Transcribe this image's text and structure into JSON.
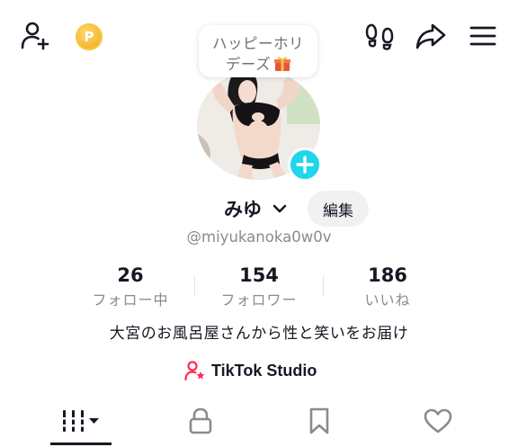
{
  "header": {
    "add_friend_icon": "person-plus-icon",
    "coin_icon": "coin-icon",
    "coin_glyph": "P",
    "footprints_icon": "footprints-icon",
    "share_icon": "share-arrow-icon",
    "menu_icon": "hamburger-menu-icon"
  },
  "holiday_bubble": {
    "line1": "ハッピーホリ",
    "line2": "デーズ",
    "icon": "gift-icon"
  },
  "profile": {
    "username": "みゆ",
    "edit_label": "編集",
    "handle": "@miyukanoka0w0v",
    "bio": "大宮のお風呂屋さんから性と笑いをお届け"
  },
  "stats": {
    "following": {
      "value": "26",
      "label": "フォロー中"
    },
    "followers": {
      "value": "154",
      "label": "フォロワー"
    },
    "likes": {
      "value": "186",
      "label": "いいね"
    }
  },
  "studio": {
    "label": "TikTok Studio",
    "icon": "person-star-icon",
    "icon_color": "#fe2c55"
  },
  "tabs": [
    {
      "name": "videos",
      "icon": "grid-bars-icon",
      "active": true
    },
    {
      "name": "private",
      "icon": "lock-icon",
      "active": false
    },
    {
      "name": "favorites",
      "icon": "bookmark-icon",
      "active": false
    },
    {
      "name": "liked",
      "icon": "heart-icon",
      "active": false
    }
  ],
  "colors": {
    "accent_cyan": "#20d5ec",
    "text_primary": "#161823",
    "text_secondary": "#8a8b91",
    "edit_bg": "#f1f1f2"
  }
}
